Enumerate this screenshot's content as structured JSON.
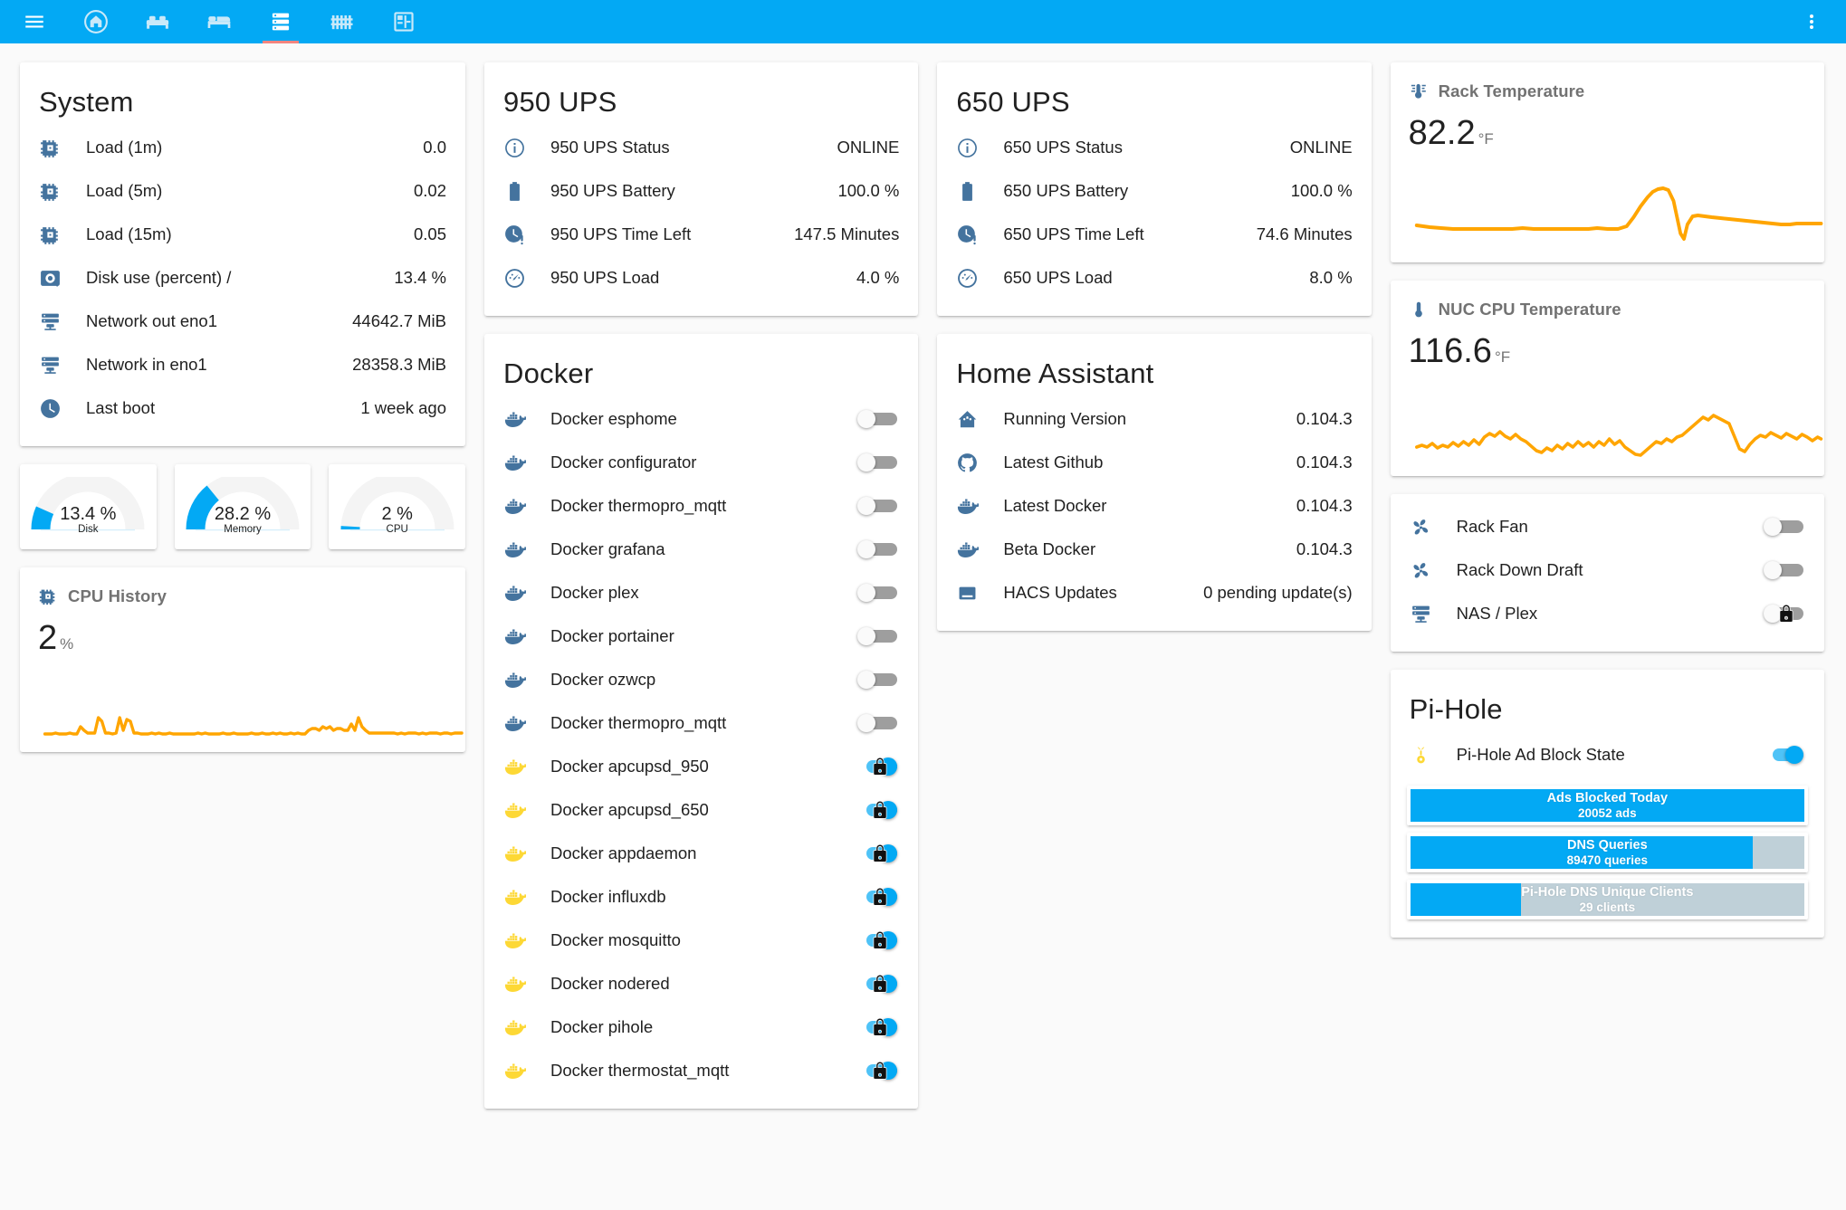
{
  "appbar": {
    "menu_icon": "hamburger-menu-icon",
    "tabs": [
      {
        "name": "tab-home",
        "icon": "home-icon",
        "active": false
      },
      {
        "name": "tab-living-room",
        "icon": "sofa-icon",
        "active": false
      },
      {
        "name": "tab-bedroom",
        "icon": "bed-icon",
        "active": false
      },
      {
        "name": "tab-server",
        "icon": "server-rack-icon",
        "active": true
      },
      {
        "name": "tab-fence",
        "icon": "fence-icon",
        "active": false
      },
      {
        "name": "tab-floorplan",
        "icon": "floor-plan-icon",
        "active": false
      }
    ],
    "overflow_icon": "dots-vertical-icon",
    "accent": "#03A9F4",
    "active_underline": "#F4857F"
  },
  "system": {
    "title": "System",
    "rows": [
      {
        "icon": "cpu-icon",
        "label": "Load (1m)",
        "value": "0.0"
      },
      {
        "icon": "cpu-icon",
        "label": "Load (5m)",
        "value": "0.02"
      },
      {
        "icon": "cpu-icon",
        "label": "Load (15m)",
        "value": "0.05"
      },
      {
        "icon": "harddisk-icon",
        "label": "Disk use (percent) /",
        "value": "13.4 %"
      },
      {
        "icon": "server-icon",
        "label": "Network out eno1",
        "value": "44642.7 MiB"
      },
      {
        "icon": "server-icon",
        "label": "Network in eno1",
        "value": "28358.3 MiB"
      },
      {
        "icon": "clock-icon",
        "label": "Last boot",
        "value": "1 week ago"
      }
    ]
  },
  "gauges": [
    {
      "value": "13.4 %",
      "label": "Disk",
      "percent": 13.4
    },
    {
      "value": "28.2 %",
      "label": "Memory",
      "percent": 28.2
    },
    {
      "value": "2 %",
      "label": "CPU",
      "percent": 2
    }
  ],
  "cpu_history": {
    "icon": "cpu-icon",
    "title": "CPU History",
    "value": "2",
    "unit": "%",
    "line_color": "#FFA500"
  },
  "ups_950": {
    "title": "950 UPS",
    "rows": [
      {
        "icon": "information-icon",
        "label": "950 UPS Status",
        "value": "ONLINE"
      },
      {
        "icon": "battery-icon",
        "label": "950 UPS Battery",
        "value": "100.0 %"
      },
      {
        "icon": "clock-alert-icon",
        "label": "950 UPS Time Left",
        "value": "147.5 Minutes"
      },
      {
        "icon": "gauge-icon",
        "label": "950 UPS Load",
        "value": "4.0 %"
      }
    ]
  },
  "ups_650": {
    "title": "650 UPS",
    "rows": [
      {
        "icon": "information-icon",
        "label": "650 UPS Status",
        "value": "ONLINE"
      },
      {
        "icon": "battery-icon",
        "label": "650 UPS Battery",
        "value": "100.0 %"
      },
      {
        "icon": "clock-alert-icon",
        "label": "650 UPS Time Left",
        "value": "74.6 Minutes"
      },
      {
        "icon": "gauge-icon",
        "label": "650 UPS Load",
        "value": "8.0 %"
      }
    ]
  },
  "docker": {
    "title": "Docker",
    "rows": [
      {
        "icon": "docker-icon",
        "label": "Docker esphome",
        "state": "off",
        "locked": false
      },
      {
        "icon": "docker-icon",
        "label": "Docker configurator",
        "state": "off",
        "locked": false
      },
      {
        "icon": "docker-icon",
        "label": "Docker thermopro_mqtt",
        "state": "off",
        "locked": false
      },
      {
        "icon": "docker-icon",
        "label": "Docker grafana",
        "state": "off",
        "locked": false
      },
      {
        "icon": "docker-icon",
        "label": "Docker plex",
        "state": "off",
        "locked": false
      },
      {
        "icon": "docker-icon",
        "label": "Docker portainer",
        "state": "off",
        "locked": false
      },
      {
        "icon": "docker-icon",
        "label": "Docker ozwcp",
        "state": "off",
        "locked": false
      },
      {
        "icon": "docker-icon",
        "label": "Docker thermopro_mqtt",
        "state": "off",
        "locked": false
      },
      {
        "icon": "docker-icon",
        "label": "Docker apcupsd_950",
        "state": "on",
        "locked": true
      },
      {
        "icon": "docker-icon",
        "label": "Docker apcupsd_650",
        "state": "on",
        "locked": true
      },
      {
        "icon": "docker-icon",
        "label": "Docker appdaemon",
        "state": "on",
        "locked": true
      },
      {
        "icon": "docker-icon",
        "label": "Docker influxdb",
        "state": "on",
        "locked": true
      },
      {
        "icon": "docker-icon",
        "label": "Docker mosquitto",
        "state": "on",
        "locked": true
      },
      {
        "icon": "docker-icon",
        "label": "Docker nodered",
        "state": "on",
        "locked": true
      },
      {
        "icon": "docker-icon",
        "label": "Docker pihole",
        "state": "on",
        "locked": true
      },
      {
        "icon": "docker-icon",
        "label": "Docker thermostat_mqtt",
        "state": "on",
        "locked": true
      }
    ],
    "icon_color_off": "#44739E",
    "icon_color_on": "#FDD835"
  },
  "home_assistant": {
    "title": "Home Assistant",
    "rows": [
      {
        "icon": "home-assistant-icon",
        "label": "Running Version",
        "value": "0.104.3"
      },
      {
        "icon": "github-icon",
        "label": "Latest Github",
        "value": "0.104.3"
      },
      {
        "icon": "docker-icon",
        "label": "Latest Docker",
        "value": "0.104.3"
      },
      {
        "icon": "docker-icon",
        "label": "Beta Docker",
        "value": "0.104.3"
      },
      {
        "icon": "hacs-icon",
        "label": "HACS Updates",
        "value": "0 pending update(s)"
      }
    ]
  },
  "rack_temperature": {
    "icon": "thermometer-lines-icon",
    "title": "Rack Temperature",
    "value": "82.2",
    "unit": "°F",
    "line_color": "#FFA500"
  },
  "nuc_cpu_temperature": {
    "icon": "thermometer-icon",
    "title": "NUC CPU Temperature",
    "value": "116.6",
    "unit": "°F",
    "line_color": "#FFA500"
  },
  "rack_controls": {
    "rows": [
      {
        "icon": "fan-icon",
        "label": "Rack Fan",
        "state": "off",
        "locked": false
      },
      {
        "icon": "fan-icon",
        "label": "Rack Down Draft",
        "state": "off",
        "locked": false
      },
      {
        "icon": "server-icon",
        "label": "NAS / Plex",
        "state": "off",
        "locked": true
      }
    ]
  },
  "pihole": {
    "title": "Pi-Hole",
    "toggle_row": {
      "icon": "pi-hole-icon",
      "label": "Pi-Hole Ad Block State",
      "state": "on"
    },
    "bars": [
      {
        "label": "Ads Blocked Today",
        "sub": "20052 ads",
        "percent": 100
      },
      {
        "label": "DNS Queries",
        "sub": "89470 queries",
        "percent": 87
      },
      {
        "label": "Pi-Hole DNS Unique Clients",
        "sub": "29 clients",
        "percent": 28
      }
    ],
    "fill_color": "#03A9F4",
    "track_color": "#BFD0D8"
  },
  "chart_data": [
    {
      "type": "line",
      "title": "CPU History",
      "ylabel": "%",
      "line_color": "#FFA500",
      "y": [
        4,
        4,
        4,
        5,
        4,
        4,
        4,
        5,
        4,
        4,
        8,
        6,
        5,
        5,
        5,
        12,
        10,
        5,
        5,
        4,
        5,
        12,
        6,
        11,
        10,
        5,
        5,
        4,
        4,
        4,
        5,
        4,
        5,
        4,
        4,
        5,
        4,
        4,
        4,
        4,
        4,
        4,
        4,
        5,
        4,
        5,
        4,
        4,
        4,
        4,
        5,
        4,
        4,
        5,
        4,
        4,
        4,
        4,
        5,
        4,
        4,
        5,
        4,
        4,
        5,
        4,
        5,
        4,
        4,
        5,
        4,
        5,
        4,
        4,
        6,
        7,
        7,
        6,
        8,
        7,
        8,
        6,
        7,
        7,
        6,
        6,
        9,
        6,
        12,
        8,
        6,
        5,
        5,
        5,
        5,
        5,
        5,
        5,
        5,
        4,
        5,
        4,
        5,
        5,
        5,
        4,
        5,
        4,
        5,
        5,
        5,
        4,
        5,
        5,
        4,
        5,
        5,
        5,
        4,
        5,
        5,
        5,
        5,
        4,
        5,
        5,
        5,
        5,
        4,
        5
      ]
    },
    {
      "type": "line",
      "title": "Rack Temperature",
      "ylabel": "°F",
      "line_color": "#FFA500",
      "y": [
        30,
        29,
        29,
        28,
        28,
        28,
        28,
        28,
        28,
        28,
        28,
        28,
        29,
        28,
        28,
        28,
        28,
        28,
        28,
        28,
        28,
        28,
        28,
        28,
        28,
        28,
        28,
        28,
        28,
        28,
        28,
        29,
        30,
        34,
        42,
        50,
        58,
        64,
        68,
        70,
        71,
        72,
        71,
        70,
        45,
        18,
        12,
        28,
        44,
        46,
        45,
        44,
        44,
        44,
        43,
        43,
        44,
        43,
        42,
        42,
        41,
        41,
        40,
        40,
        39,
        39,
        38,
        38,
        37,
        37,
        36,
        36,
        35,
        35,
        34,
        34,
        33,
        33,
        33,
        32,
        32,
        31,
        31,
        31,
        31,
        32,
        32,
        32,
        32,
        32,
        32,
        32,
        32,
        32,
        32,
        32
      ]
    },
    {
      "type": "line",
      "title": "NUC CPU Temperature",
      "ylabel": "°F",
      "line_color": "#FFA500",
      "y": [
        28,
        30,
        28,
        31,
        27,
        30,
        28,
        32,
        29,
        33,
        30,
        34,
        31,
        36,
        40,
        38,
        42,
        38,
        36,
        40,
        36,
        34,
        30,
        26,
        24,
        28,
        26,
        30,
        27,
        32,
        29,
        34,
        31,
        33,
        30,
        34,
        32,
        36,
        33,
        35,
        30,
        26,
        22,
        20,
        26,
        30,
        34,
        32,
        36,
        34,
        38,
        40,
        44,
        48,
        52,
        58,
        62,
        60,
        64,
        62,
        60,
        58,
        44,
        30,
        26,
        34,
        40,
        44,
        42,
        46,
        44,
        42,
        40,
        44,
        42,
        40,
        38,
        42,
        40,
        38,
        36,
        40,
        38,
        36,
        34,
        38,
        36,
        34,
        32,
        36,
        34,
        38,
        36,
        34,
        32,
        36,
        34,
        38,
        36,
        34,
        38,
        36,
        40,
        38
      ]
    }
  ]
}
